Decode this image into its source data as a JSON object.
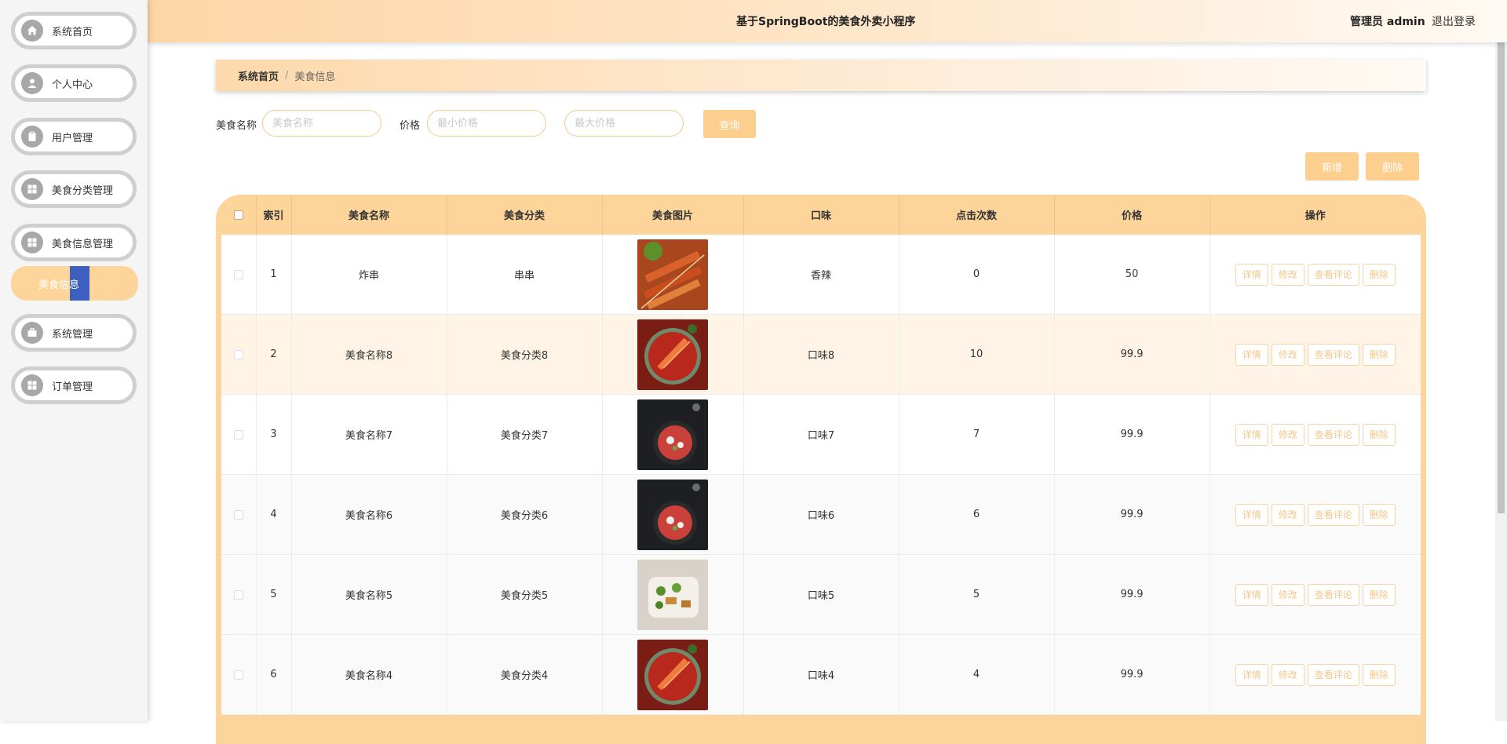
{
  "header": {
    "title": "基于SpringBoot的美食外卖小程序",
    "user": "管理员 admin",
    "logout": "退出登录"
  },
  "sidebar": {
    "items": [
      {
        "label": "系统首页",
        "icon": "home-icon"
      },
      {
        "label": "个人中心",
        "icon": "user-icon"
      },
      {
        "label": "用户管理",
        "icon": "clipboard-icon"
      },
      {
        "label": "美食分类管理",
        "icon": "grid-icon"
      },
      {
        "label": "美食信息管理",
        "icon": "grid-icon"
      },
      {
        "label": "系统管理",
        "icon": "briefcase-icon"
      },
      {
        "label": "订单管理",
        "icon": "grid-icon"
      }
    ],
    "active_sub": "美食信息"
  },
  "breadcrumb": {
    "home": "系统首页",
    "separator": "/",
    "current": "美食信息"
  },
  "search": {
    "name_label": "美食名称",
    "name_placeholder": "美食名称",
    "price_label": "价格",
    "min_placeholder": "最小价格",
    "max_placeholder": "最大价格",
    "query_button": "查询"
  },
  "actions": {
    "add": "新增",
    "delete": "删除"
  },
  "table": {
    "columns": [
      "索引",
      "美食名称",
      "美食分类",
      "美食图片",
      "口味",
      "点击次数",
      "价格",
      "操作"
    ],
    "row_buttons": [
      "详情",
      "修改",
      "查看评论",
      "删除"
    ],
    "rows": [
      {
        "index": "1",
        "name": "炸串",
        "category": "串串",
        "flavor": "香辣",
        "clicks": "0",
        "price": "50",
        "image": "skewers-photo"
      },
      {
        "index": "2",
        "name": "美食名称8",
        "category": "美食分类8",
        "flavor": "口味8",
        "clicks": "10",
        "price": "99.9",
        "image": "crayfish-photo"
      },
      {
        "index": "3",
        "name": "美食名称7",
        "category": "美食分类7",
        "flavor": "口味7",
        "clicks": "7",
        "price": "99.9",
        "image": "fish-soup-photo"
      },
      {
        "index": "4",
        "name": "美食名称6",
        "category": "美食分类6",
        "flavor": "口味6",
        "clicks": "6",
        "price": "99.9",
        "image": "fish-soup-photo"
      },
      {
        "index": "5",
        "name": "美食名称5",
        "category": "美食分类5",
        "flavor": "口味5",
        "clicks": "5",
        "price": "99.9",
        "image": "stir-fry-photo"
      },
      {
        "index": "6",
        "name": "美食名称4",
        "category": "美食分类4",
        "flavor": "口味4",
        "clicks": "4",
        "price": "99.9",
        "image": "crayfish-photo"
      }
    ]
  },
  "colors": {
    "accent": "#fdd59b",
    "button": "#fdcf8e",
    "selection": "#3d5fc0"
  }
}
